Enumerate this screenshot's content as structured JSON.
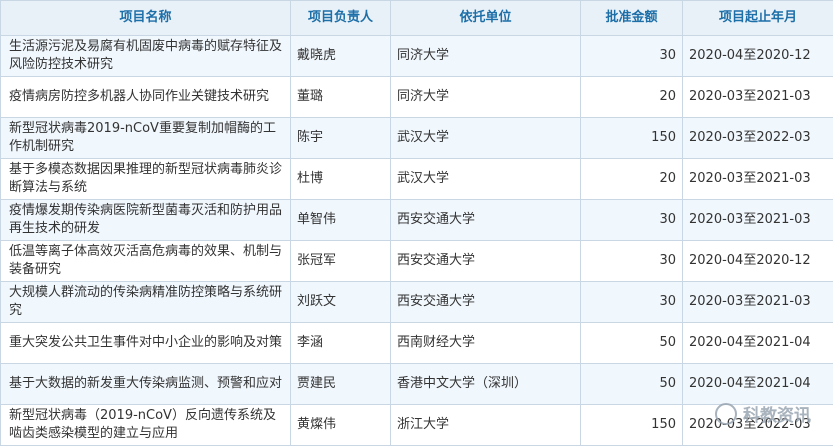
{
  "table": {
    "headers": [
      "项目名称",
      "项目负责人",
      "依托单位",
      "批准金额",
      "项目起止年月"
    ],
    "rows": [
      [
        "生活源污泥及易腐有机固废中病毒的赋存特征及风险防控技术研究",
        "戴晓虎",
        "同济大学",
        "30",
        "2020-04至2020-12"
      ],
      [
        "疫情病房防控多机器人协同作业关键技术研究",
        "董璐",
        "同济大学",
        "20",
        "2020-03至2021-03"
      ],
      [
        "新型冠状病毒2019-nCoV重要复制加帽酶的工作机制研究",
        "陈宇",
        "武汉大学",
        "150",
        "2020-03至2022-03"
      ],
      [
        "基于多模态数据因果推理的新型冠状病毒肺炎诊断算法与系统",
        "杜博",
        "武汉大学",
        "20",
        "2020-03至2021-03"
      ],
      [
        "疫情爆发期传染病医院新型菌毒灭活和防护用品再生技术的研发",
        "单智伟",
        "西安交通大学",
        "30",
        "2020-03至2021-03"
      ],
      [
        "低温等离子体高效灭活高危病毒的效果、机制与装备研究",
        "张冠军",
        "西安交通大学",
        "30",
        "2020-04至2020-12"
      ],
      [
        "大规模人群流动的传染病精准防控策略与系统研究",
        "刘跃文",
        "西安交通大学",
        "30",
        "2020-03至2021-03"
      ],
      [
        "重大突发公共卫生事件对中小企业的影响及对策",
        "李涵",
        "西南财经大学",
        "50",
        "2020-04至2021-04"
      ],
      [
        "基于大数据的新发重大传染病监测、预警和应对",
        "贾建民",
        "香港中文大学（深圳）",
        "50",
        "2020-04至2021-04"
      ],
      [
        "新型冠状病毒（2019-nCoV）反向遗传系统及啮齿类感染模型的建立与应用",
        "黄燦伟",
        "浙江大学",
        "150",
        "2020-03至2022-03"
      ]
    ]
  },
  "watermark": {
    "text": "科教资讯",
    "icon": "wechat-icon"
  },
  "colors": {
    "header_bg": "#e9f1f8",
    "header_text": "#1d6fa8",
    "row_alt_bg": "#f0f7fd",
    "border": "#c9d6e3"
  }
}
